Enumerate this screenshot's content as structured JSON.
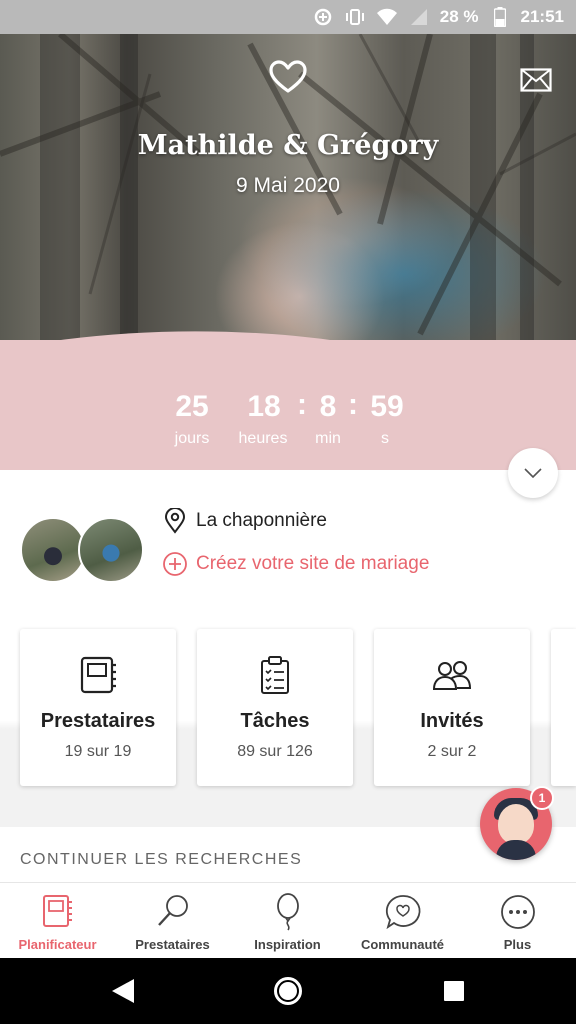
{
  "status_bar": {
    "battery": "28 %",
    "time": "21:51",
    "icons": [
      "data-saver-icon",
      "vibrate-icon",
      "wifi-icon",
      "signal-icon",
      "battery-icon"
    ]
  },
  "header": {
    "names": "Mathilde & Grégory",
    "date": "9 Mai 2020"
  },
  "countdown": {
    "days": "25",
    "days_label": "jours",
    "hours": "18",
    "hours_label": "heures",
    "minutes": "8",
    "minutes_label": "min",
    "seconds": "59",
    "seconds_label": "s",
    "separator": ":"
  },
  "info": {
    "location": "La chaponnière",
    "create_site": "Créez votre site de mariage"
  },
  "cards": [
    {
      "title": "Prestataires",
      "subtitle": "19 sur 19",
      "icon": "notebook-icon"
    },
    {
      "title": "Tâches",
      "subtitle": "89 sur 126",
      "icon": "checklist-icon"
    },
    {
      "title": "Invités",
      "subtitle": "2 sur 2",
      "icon": "guests-icon"
    }
  ],
  "section": {
    "title": "CONTINUER LES RECHERCHES"
  },
  "assistant": {
    "badge": "1"
  },
  "bottom_nav": [
    {
      "label": "Planificateur",
      "icon": "planner-icon",
      "active": true
    },
    {
      "label": "Prestataires",
      "icon": "search-icon",
      "active": false
    },
    {
      "label": "Inspiration",
      "icon": "balloon-icon",
      "active": false
    },
    {
      "label": "Communauté",
      "icon": "chat-heart-icon",
      "active": false
    },
    {
      "label": "Plus",
      "icon": "more-icon",
      "active": false
    }
  ],
  "colors": {
    "accent": "#e8656e",
    "countdown_band": "#e8c6c8"
  }
}
